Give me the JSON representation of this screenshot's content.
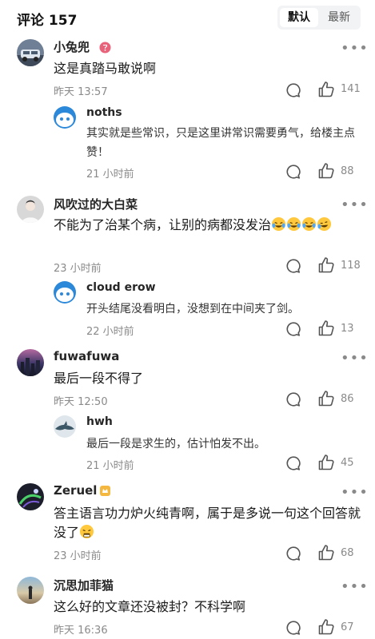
{
  "header": {
    "title": "评论 157",
    "sort_default": "默认",
    "sort_latest": "最新"
  },
  "comments": [
    {
      "user": "小兔兜",
      "text": "这是真踏马敢说啊",
      "time": "昨天 13:57",
      "likes": "141",
      "reply": {
        "user": "noths",
        "text": "其实就是些常识，只是这里讲常识需要勇气，给楼主点赞！",
        "time": "21 小时前",
        "likes": "88"
      }
    },
    {
      "user": "风吹过的大白菜",
      "text": "不能为了治某个病，让别的病都没发治",
      "time": "23 小时前",
      "likes": "118",
      "reply": {
        "user": "cloud erow",
        "text": "开头结尾没看明白，没想到在中间夹了剑。",
        "time": "22 小时前",
        "likes": "13"
      }
    },
    {
      "user": "fuwafuwa",
      "text": "最后一段不得了",
      "time": "昨天 12:50",
      "likes": "86",
      "reply": {
        "user": "hwh",
        "text": "最后一段是求生的，估计怕发不出。",
        "time": "21 小时前",
        "likes": "45"
      }
    },
    {
      "user": "Zeruel",
      "text": "答主语言功力炉火纯青啊，属于是多说一句这个回答就没了",
      "time": "23 小时前",
      "likes": "68"
    },
    {
      "user": "沉思加菲猫",
      "text": "这么好的文章还没被封？不科学啊",
      "time": "昨天 16:36",
      "likes": "67"
    }
  ],
  "icons": {
    "more": "more-dots-icon",
    "comment": "comment-bubble-icon",
    "like": "thumbs-up-icon"
  },
  "colors": {
    "secondary_text": "#8a8a8a",
    "toggle_bg": "#f2f3f5"
  }
}
